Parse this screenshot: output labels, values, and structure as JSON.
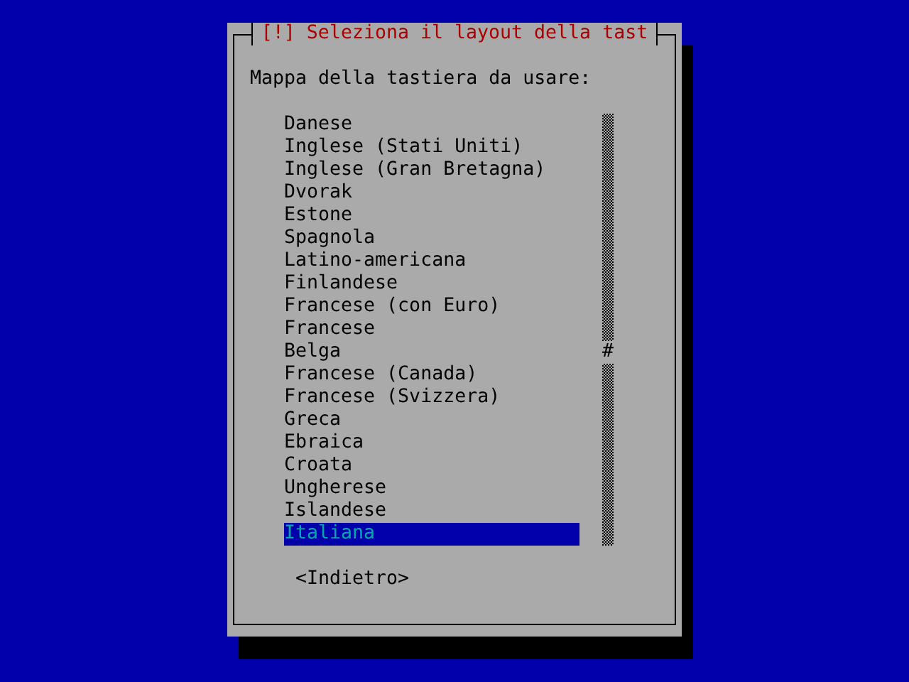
{
  "dialog": {
    "title": "[!] Seleziona il layout della tast",
    "prompt": "Mappa della tastiera da usare:",
    "items": [
      {
        "label": "Danese",
        "selected": false
      },
      {
        "label": "Inglese (Stati Uniti)",
        "selected": false
      },
      {
        "label": "Inglese (Gran Bretagna)",
        "selected": false
      },
      {
        "label": "Dvorak",
        "selected": false
      },
      {
        "label": "Estone",
        "selected": false
      },
      {
        "label": "Spagnola",
        "selected": false
      },
      {
        "label": "Latino-americana",
        "selected": false
      },
      {
        "label": "Finlandese",
        "selected": false
      },
      {
        "label": "Francese (con Euro)",
        "selected": false
      },
      {
        "label": "Francese",
        "selected": false
      },
      {
        "label": "Belga",
        "selected": false
      },
      {
        "label": "Francese (Canada)",
        "selected": false
      },
      {
        "label": "Francese (Svizzera)",
        "selected": false
      },
      {
        "label": "Greca",
        "selected": false
      },
      {
        "label": "Ebraica",
        "selected": false
      },
      {
        "label": "Croata",
        "selected": false
      },
      {
        "label": "Ungherese",
        "selected": false
      },
      {
        "label": "Islandese",
        "selected": false
      },
      {
        "label": "Italiana",
        "selected": true
      }
    ],
    "scrollbar": {
      "thumb": "#"
    },
    "buttons": [
      "<Indietro>"
    ]
  }
}
